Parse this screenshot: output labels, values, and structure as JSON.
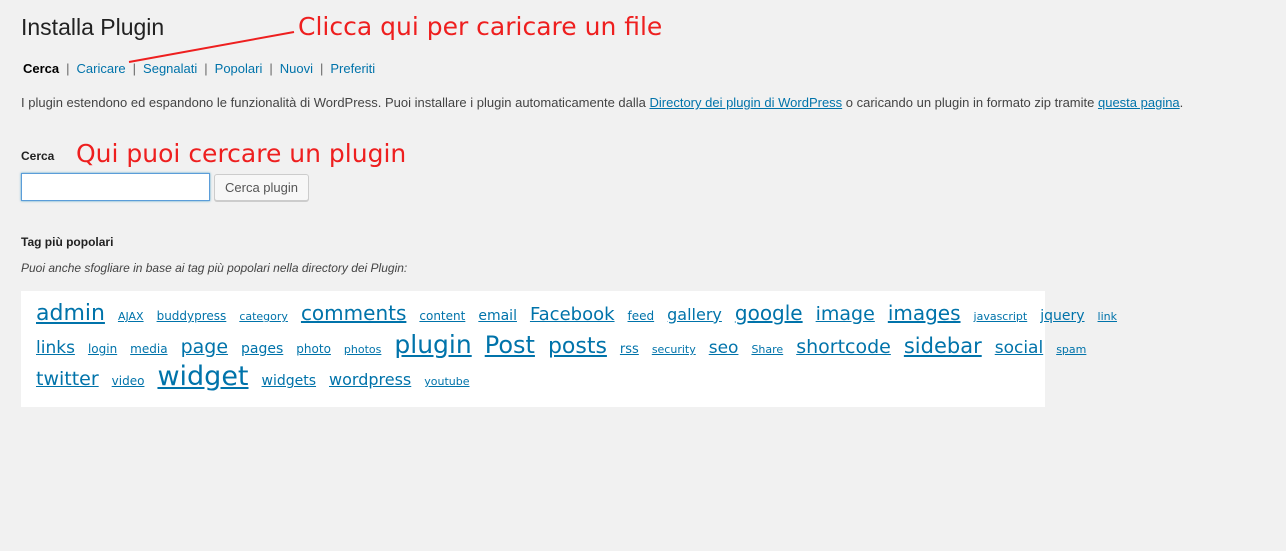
{
  "page": {
    "title": "Installa Plugin"
  },
  "annotations": {
    "upload": "Clicca qui per caricare un file",
    "search": "Qui puoi cercare un plugin"
  },
  "subnav": {
    "items": [
      {
        "label": "Cerca",
        "current": true
      },
      {
        "label": "Caricare"
      },
      {
        "label": "Segnalati"
      },
      {
        "label": "Popolari"
      },
      {
        "label": "Nuovi"
      },
      {
        "label": "Preferiti"
      }
    ],
    "separator": "|"
  },
  "intro": {
    "text_before": "I plugin estendono ed espandono le funzionalità di WordPress. Puoi installare i plugin automaticamente dalla ",
    "link1": "Directory dei plugin di WordPress",
    "text_middle": " o caricando un plugin in formato zip tramite ",
    "link2": "questa pagina",
    "text_after": "."
  },
  "search": {
    "label": "Cerca",
    "value": "",
    "button": "Cerca plugin"
  },
  "tags": {
    "heading": "Tag più popolari",
    "description": "Puoi anche sfogliare in base ai tag più popolari nella directory dei Plugin:",
    "lines": [
      [
        {
          "label": "admin",
          "size": 22
        },
        {
          "label": "AJAX",
          "size": 11
        },
        {
          "label": "buddypress",
          "size": 12
        },
        {
          "label": "category",
          "size": 11
        },
        {
          "label": "comments",
          "size": 20
        },
        {
          "label": "content",
          "size": 12
        },
        {
          "label": "email",
          "size": 14
        },
        {
          "label": "Facebook",
          "size": 18
        },
        {
          "label": "feed",
          "size": 12
        },
        {
          "label": "gallery",
          "size": 16
        },
        {
          "label": "google",
          "size": 20
        },
        {
          "label": "image",
          "size": 19
        },
        {
          "label": "images",
          "size": 20
        },
        {
          "label": "javascript",
          "size": 11
        },
        {
          "label": "jquery",
          "size": 14
        },
        {
          "label": "link",
          "size": 11
        }
      ],
      [
        {
          "label": "links",
          "size": 17
        },
        {
          "label": "login",
          "size": 12
        },
        {
          "label": "media",
          "size": 12
        },
        {
          "label": "page",
          "size": 19
        },
        {
          "label": "pages",
          "size": 14
        },
        {
          "label": "photo",
          "size": 12
        },
        {
          "label": "photos",
          "size": 11
        },
        {
          "label": "plugin",
          "size": 25
        },
        {
          "label": "Post",
          "size": 24
        },
        {
          "label": "posts",
          "size": 22
        },
        {
          "label": "rss",
          "size": 13
        },
        {
          "label": "security",
          "size": 11
        },
        {
          "label": "seo",
          "size": 17
        },
        {
          "label": "Share",
          "size": 11
        },
        {
          "label": "shortcode",
          "size": 19
        },
        {
          "label": "sidebar",
          "size": 21
        },
        {
          "label": "social",
          "size": 17
        },
        {
          "label": "spam",
          "size": 11
        }
      ],
      [
        {
          "label": "twitter",
          "size": 19
        },
        {
          "label": "video",
          "size": 12
        },
        {
          "label": "widget",
          "size": 27
        },
        {
          "label": "widgets",
          "size": 14
        },
        {
          "label": "wordpress",
          "size": 16
        },
        {
          "label": "youtube",
          "size": 11
        }
      ]
    ]
  },
  "colors": {
    "link": "#0073aa",
    "annotation": "#ee1f1f",
    "background": "#f1f1f1"
  }
}
